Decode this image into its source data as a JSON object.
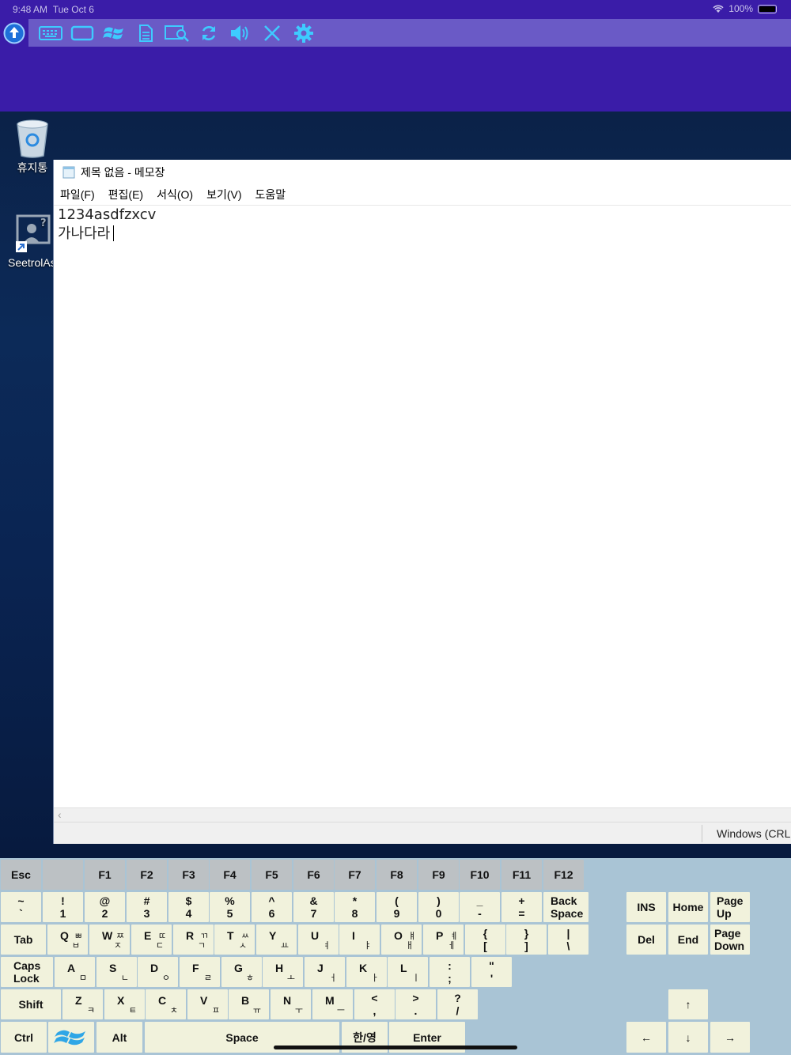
{
  "status_bar": {
    "time": "9:48 AM",
    "date": "Tue Oct 6",
    "battery_text": "100%"
  },
  "toolbar": {
    "icons": [
      "upload-circle-icon",
      "keyboard-icon",
      "screen-icon",
      "windows-icon",
      "document-icon",
      "screen-search-icon",
      "refresh-icon",
      "speaker-icon",
      "close-icon",
      "gear-icon"
    ]
  },
  "desktop": {
    "icons": [
      {
        "label": "휴지통",
        "icon": "recycle-bin-icon"
      },
      {
        "label": "SeetrolAs",
        "icon": "remote-support-icon"
      }
    ]
  },
  "notepad": {
    "title": "제목 없음 - 메모장",
    "menu": [
      "파일(F)",
      "편집(E)",
      "서식(O)",
      "보기(V)",
      "도움말"
    ],
    "lines": [
      "1234asdfzxcv",
      "가나다라"
    ],
    "status_text": "Windows (CRLF)"
  },
  "keyboard": {
    "row_fn": [
      "Esc",
      "F1",
      "F2",
      "F3",
      "F4",
      "F5",
      "F6",
      "F7",
      "F8",
      "F9",
      "F10",
      "F11",
      "F12"
    ],
    "row_num": [
      {
        "top": "~",
        "bottom": "`"
      },
      {
        "top": "!",
        "bottom": "1"
      },
      {
        "top": "@",
        "bottom": "2"
      },
      {
        "top": "#",
        "bottom": "3"
      },
      {
        "top": "$",
        "bottom": "4"
      },
      {
        "top": "%",
        "bottom": "5"
      },
      {
        "top": "^",
        "bottom": "6"
      },
      {
        "top": "&",
        "bottom": "7"
      },
      {
        "top": "*",
        "bottom": "8"
      },
      {
        "top": "(",
        "bottom": "9"
      },
      {
        "top": ")",
        "bottom": "0"
      },
      {
        "top": "_",
        "bottom": "-"
      },
      {
        "top": "+",
        "bottom": "="
      }
    ],
    "backspace": "Back\nSpace",
    "tab": "Tab",
    "row_q": [
      {
        "l": "Q",
        "h1": "ㅃ",
        "h2": "ㅂ"
      },
      {
        "l": "W",
        "h1": "ㅉ",
        "h2": "ㅈ"
      },
      {
        "l": "E",
        "h1": "ㄸ",
        "h2": "ㄷ"
      },
      {
        "l": "R",
        "h1": "ㄲ",
        "h2": "ㄱ"
      },
      {
        "l": "T",
        "h1": "ㅆ",
        "h2": "ㅅ"
      },
      {
        "l": "Y",
        "h1": "",
        "h2": "ㅛ"
      },
      {
        "l": "U",
        "h1": "",
        "h2": "ㅕ"
      },
      {
        "l": "I",
        "h1": "",
        "h2": "ㅑ"
      },
      {
        "l": "O",
        "h1": "ㅒ",
        "h2": "ㅐ"
      },
      {
        "l": "P",
        "h1": "ㅖ",
        "h2": "ㅔ"
      }
    ],
    "row_q_sym": [
      {
        "top": "{",
        "bottom": "["
      },
      {
        "top": "}",
        "bottom": "]"
      },
      {
        "top": "|",
        "bottom": "\\"
      }
    ],
    "caps": "Caps\nLock",
    "row_a": [
      {
        "l": "A",
        "h2": "ㅁ"
      },
      {
        "l": "S",
        "h2": "ㄴ"
      },
      {
        "l": "D",
        "h2": "ㅇ"
      },
      {
        "l": "F",
        "h2": "ㄹ"
      },
      {
        "l": "G",
        "h2": "ㅎ"
      },
      {
        "l": "H",
        "h2": "ㅗ"
      },
      {
        "l": "J",
        "h2": "ㅓ"
      },
      {
        "l": "K",
        "h2": "ㅏ"
      },
      {
        "l": "L",
        "h2": "ㅣ"
      }
    ],
    "row_a_sym": [
      {
        "top": ":",
        "bottom": ";"
      },
      {
        "top": "\"",
        "bottom": "'"
      }
    ],
    "shift": "Shift",
    "row_z": [
      {
        "l": "Z",
        "h2": "ㅋ"
      },
      {
        "l": "X",
        "h2": "ㅌ"
      },
      {
        "l": "C",
        "h2": "ㅊ"
      },
      {
        "l": "V",
        "h2": "ㅍ"
      },
      {
        "l": "B",
        "h2": "ㅠ"
      },
      {
        "l": "N",
        "h2": "ㅜ"
      },
      {
        "l": "M",
        "h2": "ㅡ"
      }
    ],
    "row_z_sym": [
      {
        "top": "<",
        "bottom": ","
      },
      {
        "top": ">",
        "bottom": "."
      },
      {
        "top": "?",
        "bottom": "/"
      }
    ],
    "ctrl": "Ctrl",
    "alt": "Alt",
    "space": "Space",
    "hangul": "한/영",
    "enter": "Enter",
    "ins": "INS",
    "home": "Home",
    "pgup": "Page\nUp",
    "del": "Del",
    "end": "End",
    "pgdn": "Page\nDown",
    "up": "↑",
    "left": "←",
    "down": "↓",
    "right": "→"
  }
}
